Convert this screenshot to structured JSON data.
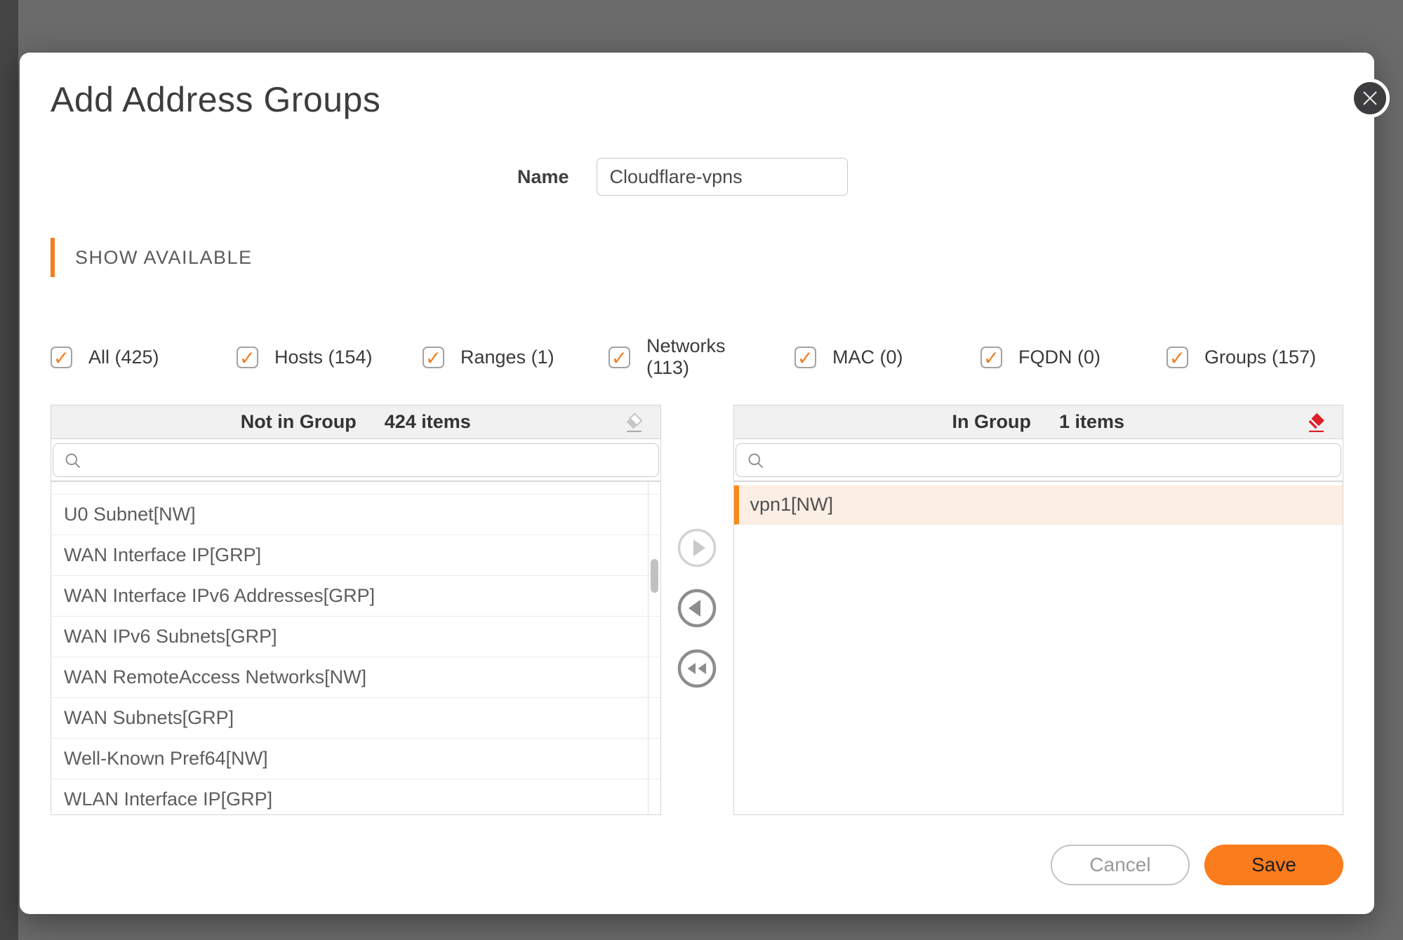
{
  "dialog": {
    "title": "Add Address Groups"
  },
  "name_field": {
    "label": "Name",
    "value": "Cloudflare-vpns"
  },
  "section": {
    "title": "SHOW AVAILABLE"
  },
  "icons": {
    "check": "✓"
  },
  "filters": [
    {
      "label": "All (425)",
      "checked": true
    },
    {
      "label": "Hosts (154)",
      "checked": true
    },
    {
      "label": "Ranges (1)",
      "checked": true
    },
    {
      "label": "Networks (113)",
      "checked": true
    },
    {
      "label": "MAC (0)",
      "checked": true
    },
    {
      "label": "FQDN (0)",
      "checked": true
    },
    {
      "label": "Groups (157)",
      "checked": true
    }
  ],
  "left_panel": {
    "title": "Not in Group",
    "count": "424 items",
    "search_value": "",
    "items": [
      "U0 Subnet[NW]",
      "WAN Interface IP[GRP]",
      "WAN Interface IPv6 Addresses[GRP]",
      "WAN IPv6 Subnets[GRP]",
      "WAN RemoteAccess Networks[NW]",
      "WAN Subnets[GRP]",
      "Well-Known Pref64[NW]",
      "WLAN Interface IP[GRP]"
    ]
  },
  "right_panel": {
    "title": "In Group",
    "count": "1 items",
    "search_value": "",
    "items": [
      "vpn1[NW]"
    ],
    "selected_index": 0
  },
  "footer": {
    "cancel_label": "Cancel",
    "save_label": "Save"
  },
  "colors": {
    "accent_orange": "#F87B1B",
    "check_orange": "#F47F20",
    "selected_row_bg": "#FBEEE3",
    "selected_row_border": "#F68B1E",
    "eraser_red": "#DD1F26",
    "save_button_bg": "#FA7C1D",
    "overlay_gray": "#6B6B6B"
  }
}
